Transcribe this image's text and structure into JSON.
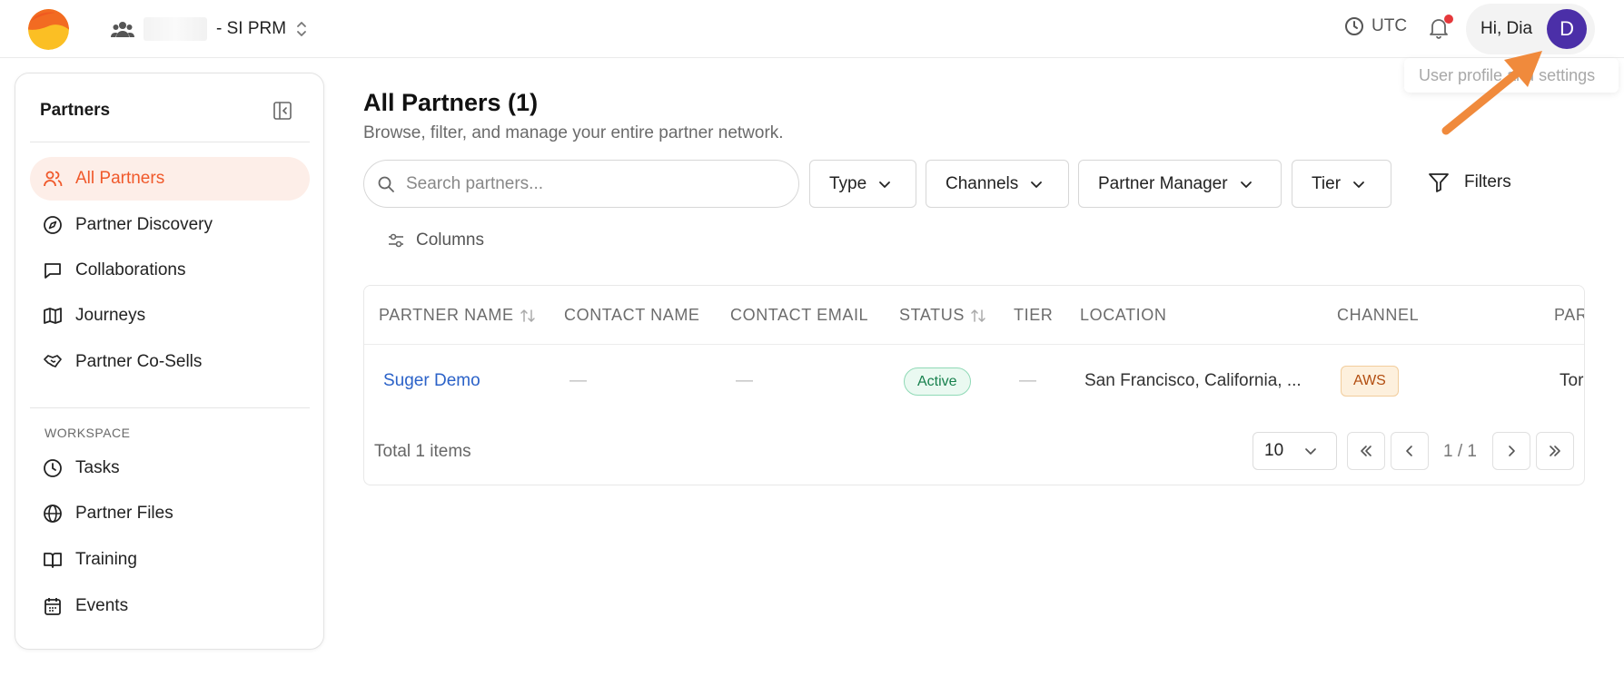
{
  "header": {
    "org_suffix": "- SI PRM",
    "timezone": "UTC",
    "greeting": "Hi, Dia",
    "avatar_initial": "D",
    "tooltip": "User profile and settings"
  },
  "sidebar": {
    "title": "Partners",
    "items": [
      {
        "label": "All Partners",
        "icon": "users-icon",
        "active": true
      },
      {
        "label": "Partner Discovery",
        "icon": "compass-icon"
      },
      {
        "label": "Collaborations",
        "icon": "message-square-icon"
      },
      {
        "label": "Journeys",
        "icon": "map-icon"
      },
      {
        "label": "Partner Co-Sells",
        "icon": "handshake-icon"
      }
    ],
    "section_label": "WORKSPACE",
    "workspace_items": [
      {
        "label": "Tasks",
        "icon": "clock-icon"
      },
      {
        "label": "Partner Files",
        "icon": "globe-icon"
      },
      {
        "label": "Training",
        "icon": "book-open-icon"
      },
      {
        "label": "Events",
        "icon": "calendar-icon"
      }
    ]
  },
  "main": {
    "title": "All Partners (1)",
    "subtitle": "Browse, filter, and manage your entire partner network.",
    "search_placeholder": "Search partners...",
    "filters": {
      "type": "Type",
      "channels": "Channels",
      "partner_manager": "Partner Manager",
      "tier": "Tier",
      "filters": "Filters",
      "columns": "Columns"
    },
    "table": {
      "headers": [
        "PARTNER NAME",
        "CONTACT NAME",
        "CONTACT EMAIL",
        "STATUS",
        "TIER",
        "LOCATION",
        "CHANNEL",
        "PAR"
      ],
      "row": {
        "partner_name": "Suger Demo",
        "contact_name": "—",
        "contact_email": "—",
        "status": "Active",
        "tier": "—",
        "location": "San Francisco, California, ...",
        "channel": "AWS",
        "partial": "Tor"
      }
    },
    "pagination": {
      "total": "Total 1 items",
      "page_size": "10",
      "page_indicator": "1 / 1"
    }
  },
  "colors": {
    "accent": "#f0592b",
    "avatar": "#4b2fa8",
    "link": "#2b62c8",
    "arrow": "#f08a3c"
  }
}
